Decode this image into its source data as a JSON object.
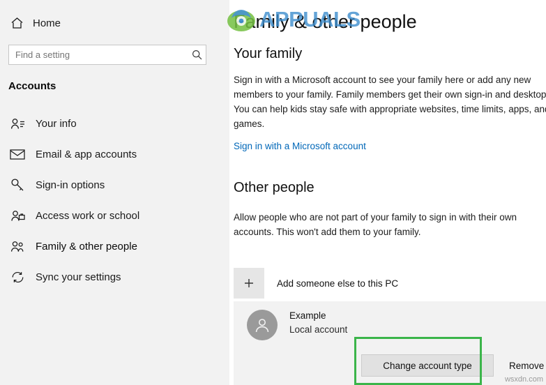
{
  "left": {
    "home": {
      "label": "Home",
      "icon": "home-icon"
    },
    "search": {
      "placeholder": "Find a setting",
      "value": "",
      "icon": "search-icon"
    },
    "section_title": "Accounts",
    "items": [
      {
        "label": "Your info",
        "icon": "user-info-icon"
      },
      {
        "label": "Email & app accounts",
        "icon": "envelope-icon"
      },
      {
        "label": "Sign-in options",
        "icon": "key-icon"
      },
      {
        "label": "Access work or school",
        "icon": "briefcase-icon"
      },
      {
        "label": "Family & other people",
        "icon": "people-icon",
        "selected": true
      },
      {
        "label": "Sync your settings",
        "icon": "sync-icon"
      }
    ]
  },
  "main": {
    "title": "Family & other people",
    "your_family": {
      "heading": "Your family",
      "description": "Sign in with a Microsoft account to see your family here or add any new members to your family. Family members get their own sign-in and desktop. You can help kids stay safe with appropriate websites, time limits, apps, and games.",
      "link": "Sign in with a Microsoft account"
    },
    "other_people": {
      "heading": "Other people",
      "description": "Allow people who are not part of your family to sign in with their own accounts. This won't add them to your family.",
      "add_label": "Add someone else to this PC",
      "add_icon": "plus-icon"
    },
    "account": {
      "avatar_icon": "user-avatar-icon",
      "name": "Example",
      "type": "Local account",
      "change_type_button": "Change account type",
      "remove_button": "Remove"
    }
  },
  "overlay": {
    "highlight_color": "#3bb54a",
    "watermark_text": "APPUALS",
    "footer_text": "wsxdn.com"
  }
}
